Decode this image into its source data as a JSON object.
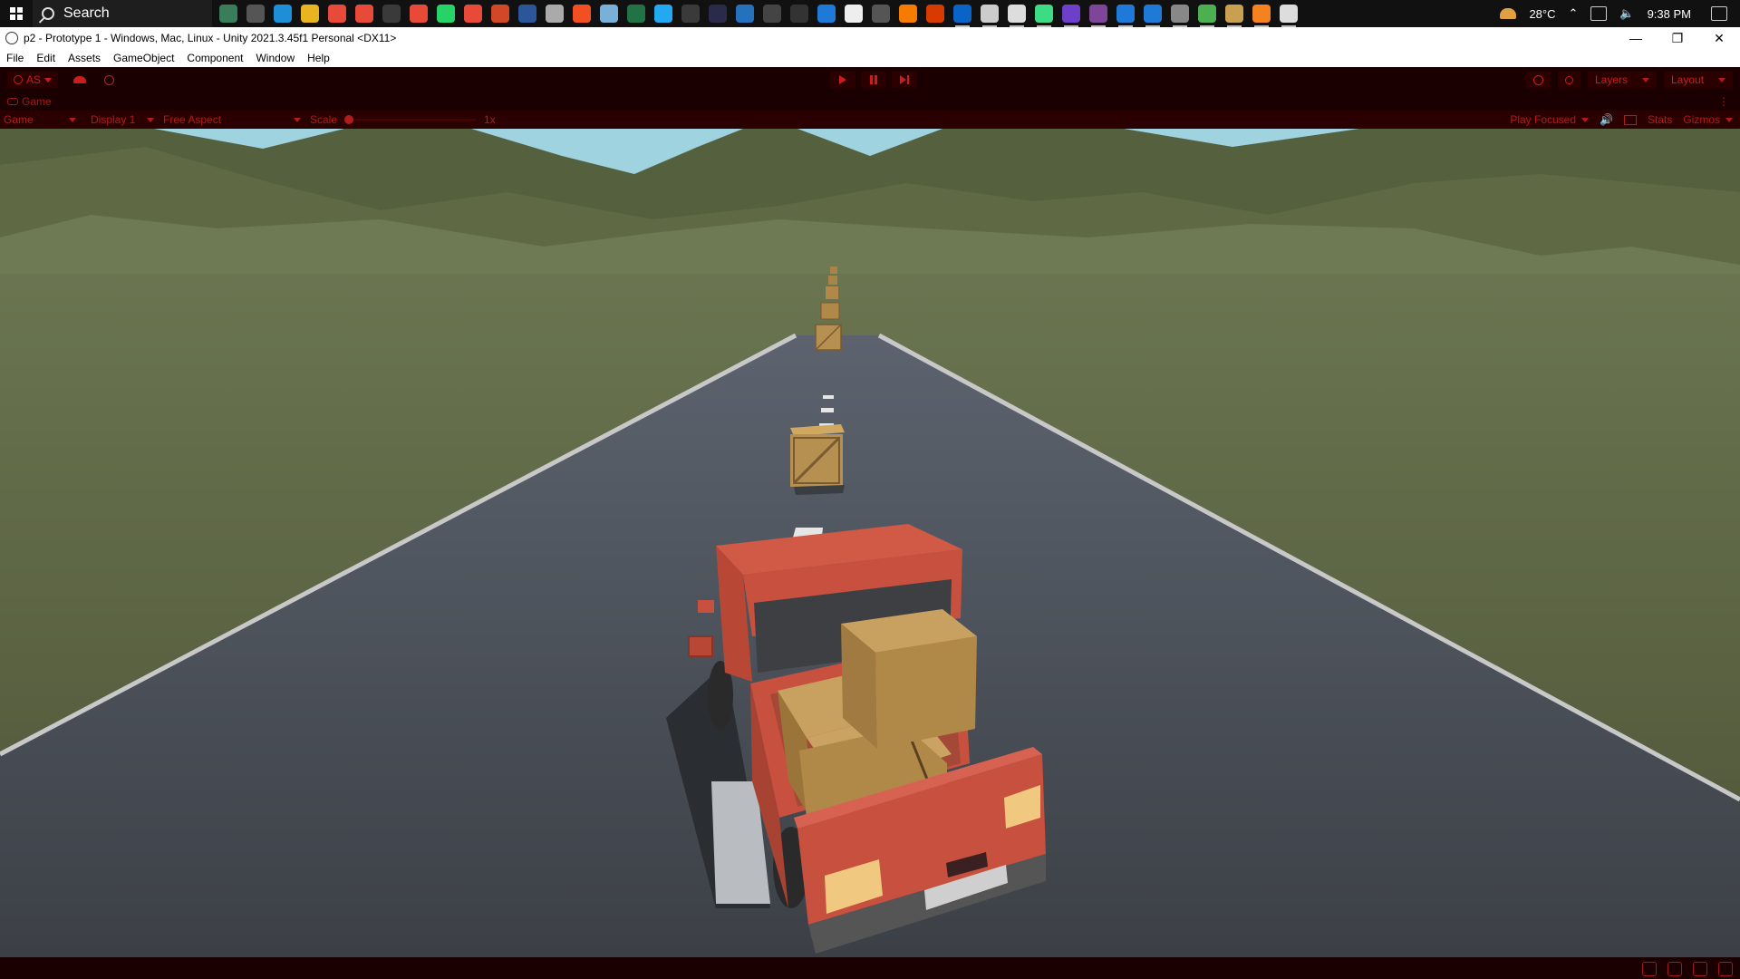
{
  "taskbar": {
    "search_label": "Search",
    "weather": "28°C",
    "clock": "9:38 PM",
    "apps": [
      {
        "icon": "news-widget-icon",
        "color": "#3a7d5a"
      },
      {
        "icon": "task-view-icon",
        "color": "#555555"
      },
      {
        "icon": "edge-icon",
        "color": "#1e8fd6"
      },
      {
        "icon": "file-explorer-icon",
        "color": "#e8b420"
      },
      {
        "icon": "chrome-icon",
        "color": "#e84a3a"
      },
      {
        "icon": "chrome-profile-icon",
        "color": "#e84a3a"
      },
      {
        "icon": "steam-icon",
        "color": "#3a3a3a"
      },
      {
        "icon": "chrome-profile2-icon",
        "color": "#e84a3a"
      },
      {
        "icon": "whatsapp-icon",
        "color": "#25d366"
      },
      {
        "icon": "chrome-profile3-icon",
        "color": "#e84a3a"
      },
      {
        "icon": "powerpoint-icon",
        "color": "#d24726"
      },
      {
        "icon": "word-icon",
        "color": "#2b579a"
      },
      {
        "icon": "weather-app-icon",
        "color": "#aaaaaa"
      },
      {
        "icon": "store-icon",
        "color": "#f25022"
      },
      {
        "icon": "notepad-icon",
        "color": "#7ab0d8"
      },
      {
        "icon": "excel-icon",
        "color": "#217346"
      },
      {
        "icon": "vscode-icon",
        "color": "#23a9f2"
      },
      {
        "icon": "tool-icon",
        "color": "#3a3a3a"
      },
      {
        "icon": "terminal-icon",
        "color": "#2a2a4a"
      },
      {
        "icon": "powershell-icon",
        "color": "#2671be"
      },
      {
        "icon": "cmd-icon",
        "color": "#444444"
      },
      {
        "icon": "obs-icon",
        "color": "#333333"
      },
      {
        "icon": "remote-icon",
        "color": "#1e7ad6"
      },
      {
        "icon": "minus-app-icon",
        "color": "#eeeeee"
      },
      {
        "icon": "clock-app-icon",
        "color": "#555555"
      },
      {
        "icon": "xampp-icon",
        "color": "#f57c00"
      },
      {
        "icon": "color-app-icon",
        "color": "#d83b01"
      },
      {
        "icon": "photoshop-icon",
        "color": "#0a64c8"
      },
      {
        "icon": "unity-hub-icon",
        "color": "#cccccc"
      },
      {
        "icon": "blender-app-icon",
        "color": "#dddddd"
      },
      {
        "icon": "android-icon",
        "color": "#3ddc84"
      },
      {
        "icon": "github-icon",
        "color": "#6e40c9"
      },
      {
        "icon": "tor-icon",
        "color": "#7d4698"
      },
      {
        "icon": "network-app-icon",
        "color": "#1e7ad6"
      },
      {
        "icon": "mysql-icon",
        "color": "#1e7ad6"
      },
      {
        "icon": "database-icon",
        "color": "#888888"
      },
      {
        "icon": "cube-app-icon",
        "color": "#4caf50"
      },
      {
        "icon": "gallery-icon",
        "color": "#c8a050"
      },
      {
        "icon": "search-app-icon",
        "color": "#f58220"
      },
      {
        "icon": "unity-editor-icon",
        "color": "#dddddd"
      }
    ]
  },
  "window": {
    "title": "p2 - Prototype 1 - Windows, Mac, Linux - Unity 2021.3.45f1 Personal <DX11>"
  },
  "menu": [
    "File",
    "Edit",
    "Assets",
    "GameObject",
    "Component",
    "Window",
    "Help"
  ],
  "toolbar": {
    "account": "AS",
    "layers": "Layers",
    "layout": "Layout"
  },
  "game_tab": {
    "label": "Game"
  },
  "game_bar": {
    "mode": "Game",
    "display": "Display 1",
    "aspect": "Free Aspect",
    "scale_label": "Scale",
    "scale_value": "1x",
    "play_focused": "Play Focused",
    "stats": "Stats",
    "gizmos": "Gizmos"
  },
  "colors": {
    "play_mode_tint": "#c81e1e",
    "sky": "#9fd3e0",
    "mountain_far": "#55603e",
    "mountain_near": "#6e7a54",
    "ground": "#68714b",
    "road": "#4a4f55",
    "truck": "#c8503f",
    "crate": "#b08848"
  }
}
